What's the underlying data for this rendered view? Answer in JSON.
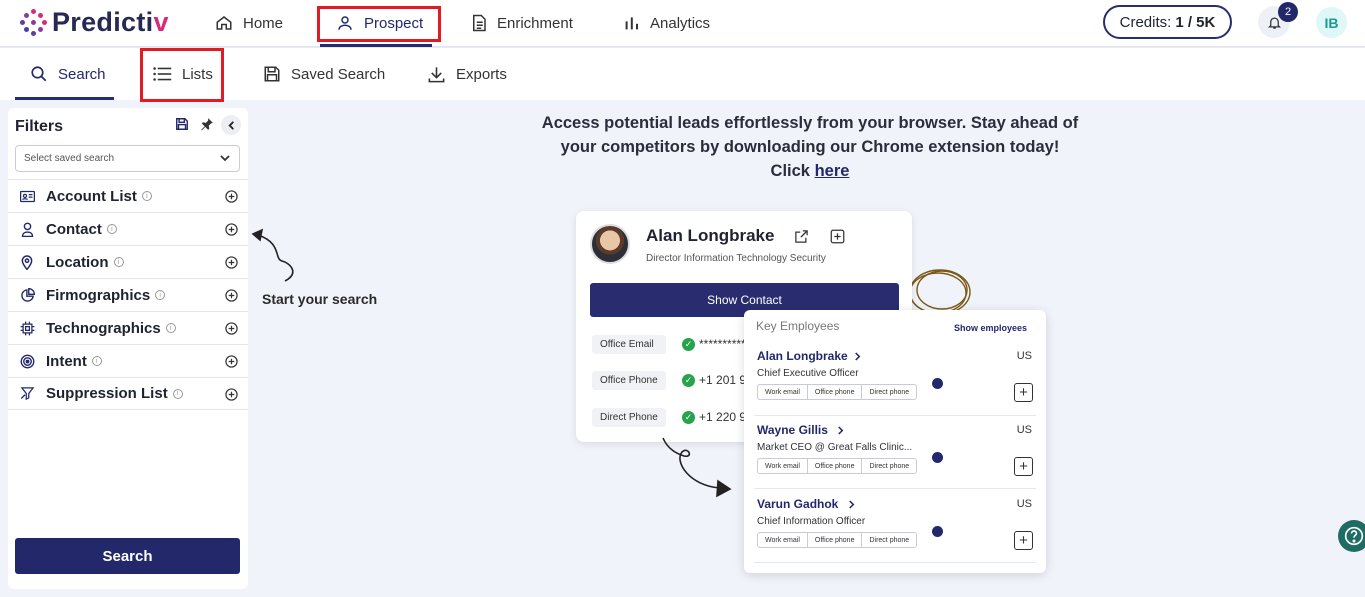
{
  "brand": {
    "logo_text": "Predicti",
    "logo_accent": "v"
  },
  "nav": {
    "items": [
      {
        "label": "Home",
        "icon": "home-icon"
      },
      {
        "label": "Prospect",
        "icon": "user-icon",
        "active": true
      },
      {
        "label": "Enrichment",
        "icon": "document-icon"
      },
      {
        "label": "Analytics",
        "icon": "bar-chart-icon"
      }
    ],
    "credits_label": "Credits:",
    "credits_value": "1 / 5K",
    "notification_count": "2",
    "user_initials": "IB"
  },
  "subtabs": [
    {
      "label": "Search",
      "icon": "search-icon",
      "active": true
    },
    {
      "label": "Lists",
      "icon": "list-icon"
    },
    {
      "label": "Saved Search",
      "icon": "save-icon"
    },
    {
      "label": "Exports",
      "icon": "download-icon"
    }
  ],
  "filters": {
    "title": "Filters",
    "saved_placeholder": "Select saved search",
    "items": [
      {
        "label": "Account List",
        "icon": "id-card-icon"
      },
      {
        "label": "Contact",
        "icon": "person-icon"
      },
      {
        "label": "Location",
        "icon": "map-pin-icon"
      },
      {
        "label": "Firmographics",
        "icon": "pie-chart-icon"
      },
      {
        "label": "Technographics",
        "icon": "chip-icon"
      },
      {
        "label": "Intent",
        "icon": "target-icon"
      },
      {
        "label": "Suppression List",
        "icon": "funnel-icon"
      }
    ],
    "search_button": "Search"
  },
  "hint": "Start your search",
  "promo": {
    "line1": "Access potential leads effortlessly from your browser. Stay ahead of",
    "line2": "your competitors by downloading our Chrome extension today!",
    "click": "Click",
    "here": "here"
  },
  "contact_card": {
    "name": "Alan Longbrake",
    "title": "Director Information Technology Security",
    "show_contact": "Show Contact",
    "rows": [
      {
        "label": "Office Email",
        "value": "***********"
      },
      {
        "label": "Office Phone",
        "value": "+1 201 9"
      },
      {
        "label": "Direct Phone",
        "value": "+1 220 9"
      }
    ]
  },
  "employees": {
    "heading": "Key Employees",
    "show_link": "Show employees",
    "pills": [
      "Work email",
      "Office phone",
      "Direct phone"
    ],
    "list": [
      {
        "name": "Alan Longbrake",
        "role": "Chief Executive Officer",
        "country": "US"
      },
      {
        "name": "Wayne Gillis",
        "role": "Market CEO @ Great Falls Clinic...",
        "country": "US"
      },
      {
        "name": "Varun Gadhok",
        "role": "Chief Information Officer",
        "country": "US"
      }
    ]
  },
  "colors": {
    "brand": "#22286a",
    "accent": "#d92a77",
    "highlight": "#e21b23",
    "success": "#27a34c"
  }
}
